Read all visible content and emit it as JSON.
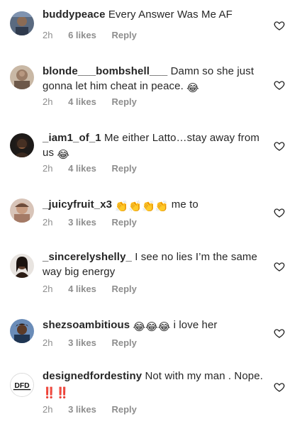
{
  "reply_label": "Reply",
  "comments": [
    {
      "username": "buddypeace",
      "text": "Every Answer Was Me AF",
      "time": "2h",
      "likes": "6 likes",
      "emojis": ""
    },
    {
      "username": "blonde___bombshell___",
      "text": "Damn so she just gonna let him cheat in peace.",
      "time": "2h",
      "likes": "4 likes",
      "emojis": "😂"
    },
    {
      "username": "_iam1_of_1",
      "text": "Me either Latto…stay away from us",
      "time": "2h",
      "likes": "4 likes",
      "emojis": "😂"
    },
    {
      "username": "_juicyfruit_x3",
      "text": "me to",
      "time": "2h",
      "likes": "3 likes",
      "emojis": "👏👏👏👏"
    },
    {
      "username": "_sincerelyshelly_",
      "text": "I see no lies I’m the same way big energy",
      "time": "2h",
      "likes": "4 likes",
      "emojis": ""
    },
    {
      "username": "shezsoambitious",
      "text": "i love her",
      "time": "2h",
      "likes": "3 likes",
      "emojis": "😂😂😂"
    },
    {
      "username": "designedfordestiny",
      "text": "Not with my man . Nope.",
      "time": "2h",
      "likes": "3 likes",
      "emojis": "‼️‼️"
    }
  ],
  "colors": {
    "username": "#262626",
    "meta": "#8e8e8e",
    "heart": "#262626"
  },
  "icons": {
    "like": "heart-outline-icon"
  },
  "avatars": {
    "designedfordestiny": "DFD"
  }
}
